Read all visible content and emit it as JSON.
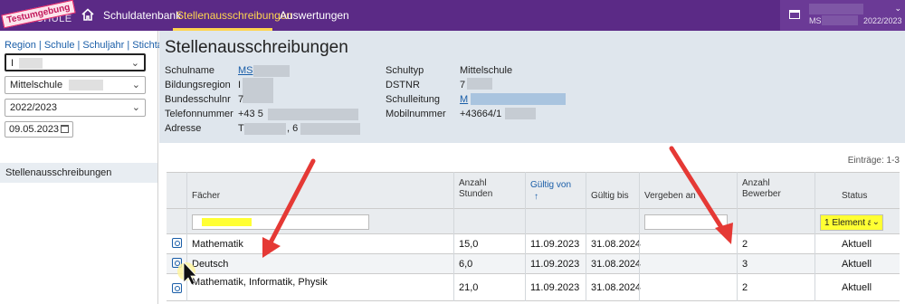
{
  "topbar": {
    "logo_brand": "",
    "logo_product": "SCHULE",
    "test_stamp": "Testumgebung",
    "nav": [
      {
        "label": "Schuldatenbank"
      },
      {
        "label": "Stellenausschreibungen"
      },
      {
        "label": "Auswertungen"
      }
    ],
    "user_school": "MS",
    "user_year": "2022/2023",
    "colors": {
      "bar": "#5b2a86",
      "active": "#ffd54f"
    }
  },
  "sidebar": {
    "crumbs": "Region | Schule | Schuljahr | Stichtag",
    "region_value": "I",
    "school_value": "Mittelschule",
    "year_value": "2022/2023",
    "date_value": "09.05.2023",
    "item": "Stellenausschreibungen"
  },
  "school": {
    "title": "Stellenausschreibungen",
    "left": [
      {
        "label": "Schulname",
        "value": "MS"
      },
      {
        "label": "Bildungsregion",
        "value": "I"
      },
      {
        "label": "Bundesschulnr",
        "value": "7"
      },
      {
        "label": "Telefonnummer",
        "value": "+43 5"
      },
      {
        "label": "Adresse",
        "value": "T",
        "value2": ", 6"
      }
    ],
    "right": [
      {
        "label": "Schultyp",
        "value": "Mittelschule"
      },
      {
        "label": "DSTNR",
        "value": "7"
      },
      {
        "label": "Schulleitung",
        "value": "M"
      },
      {
        "label": "Mobilnummer",
        "value": "+43664/1"
      }
    ]
  },
  "table": {
    "count": "Einträge: 1-3",
    "headers": {
      "faecher": "Fächer",
      "stunden": "Anzahl Stunden",
      "gueltig_von": "Gültig von",
      "gueltig_bis": "Gültig bis",
      "vergeben": "Vergeben an",
      "bewerber": "Anzahl Bewerber",
      "status": "Status"
    },
    "status_filter": "1 Element a",
    "rows": [
      {
        "faecher": "Mathematik",
        "stunden": "15,0",
        "von": "11.09.2023",
        "bis": "31.08.2024",
        "vergeben": "",
        "bewerber": "2",
        "status": "Aktuell"
      },
      {
        "faecher": "Deutsch",
        "stunden": "6,0",
        "von": "11.09.2023",
        "bis": "31.08.2024",
        "vergeben": "",
        "bewerber": "3",
        "status": "Aktuell"
      },
      {
        "faecher": "Mathematik, Informatik, Physik",
        "stunden": "21,0",
        "von": "11.09.2023",
        "bis": "31.08.2024",
        "vergeben": "",
        "bewerber": "2",
        "status": "Aktuell"
      }
    ]
  }
}
